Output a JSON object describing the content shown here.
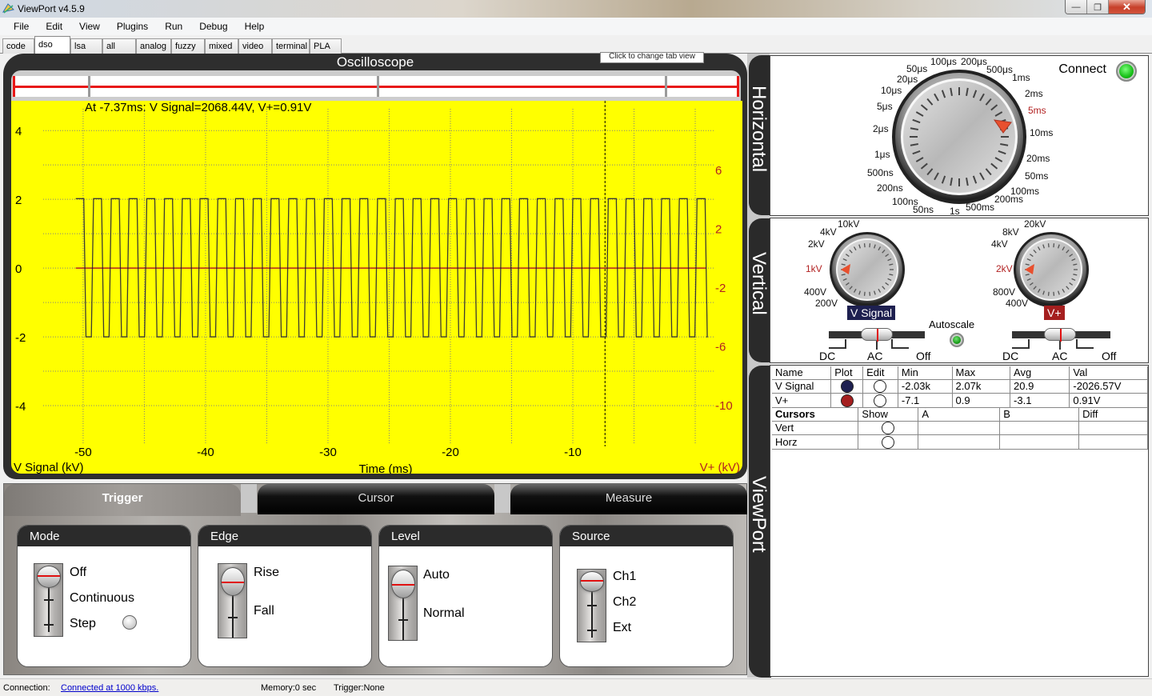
{
  "window": {
    "title": "ViewPort v4.5.9",
    "minimize": "—",
    "restore": "❐",
    "close": "✕"
  },
  "menu": [
    "File",
    "Edit",
    "View",
    "Plugins",
    "Run",
    "Debug",
    "Help"
  ],
  "tabs": [
    {
      "label": "code",
      "active": false
    },
    {
      "label": "dso",
      "active": true
    },
    {
      "label": "lsa",
      "active": false
    },
    {
      "label": "all",
      "active": false
    },
    {
      "label": "analog",
      "active": false
    },
    {
      "label": "fuzzy",
      "active": false
    },
    {
      "label": "mixed",
      "active": false
    },
    {
      "label": "video",
      "active": false
    },
    {
      "label": "terminal",
      "active": false
    },
    {
      "label": "PLA",
      "active": false
    }
  ],
  "oscilloscope": {
    "title": "Oscilloscope",
    "tab_hint": "Click to change tab view",
    "cursor_readout": "At -7.37ms: V Signal=2068.44V, V+=0.91V",
    "colors": {
      "background": "#ffff00",
      "signal": "#1a1a3a",
      "vplus": "#b22222",
      "grid": "#808080"
    }
  },
  "chart_data": {
    "type": "line",
    "title": "Oscilloscope",
    "xlabel": "Time (ms)",
    "ylabel": "V Signal (kV)",
    "y2label": "V+ (kV)",
    "xlim": [
      -53,
      1.5
    ],
    "ylim": [
      -5,
      4.4
    ],
    "y2lim": [
      -12.4,
      9.6
    ],
    "x_ticks": [
      -50,
      -40,
      -30,
      -20,
      -10
    ],
    "x_tick_labels": [
      "-50",
      "-40",
      "-30",
      "-20",
      "-10"
    ],
    "y_ticks": [
      4,
      2,
      0,
      -2,
      -4
    ],
    "y_tick_labels": [
      "4",
      "2",
      "0",
      "-2",
      "-4"
    ],
    "y2_ticks": [
      6,
      2,
      -2,
      -6,
      -10
    ],
    "y2_tick_labels": [
      "6",
      "2",
      "-2",
      "-6",
      "-10"
    ],
    "grid": true,
    "cursor_x": -7.37,
    "series": [
      {
        "name": "V Signal",
        "axis": "left",
        "shape": "square-wave",
        "high": 2.07,
        "low": -2.03,
        "x_start": -50.6,
        "x_end": 0.9,
        "period_ms": 1.45,
        "duty": 0.45
      },
      {
        "name": "V+",
        "axis": "right",
        "shape": "flat",
        "value": 0.0,
        "x_start": -50.6,
        "x_end": 0.9
      }
    ]
  },
  "trigger_panel": {
    "tabs": [
      {
        "label": "Trigger",
        "active": true
      },
      {
        "label": "Cursor",
        "active": false
      },
      {
        "label": "Measure",
        "active": false
      }
    ],
    "groups": [
      {
        "title": "Mode",
        "options": [
          "Off",
          "Continuous",
          "Step"
        ],
        "selected": "Off"
      },
      {
        "title": "Edge",
        "options": [
          "Rise",
          "Fall"
        ],
        "selected": "Rise"
      },
      {
        "title": "Level",
        "options": [
          "Auto",
          "Normal"
        ],
        "selected": "Auto"
      },
      {
        "title": "Source",
        "options": [
          "Ch1",
          "Ch2",
          "Ext"
        ],
        "selected": "Ch1"
      }
    ]
  },
  "side_tabs": [
    "Horizontal",
    "Vertical",
    "ViewPort"
  ],
  "horizontal": {
    "connect_label": "Connect",
    "timebase_labels": [
      "1s",
      "500ms",
      "200ms",
      "100ms",
      "50ms",
      "20ms",
      "10ms",
      "5ms",
      "2ms",
      "1ms",
      "500μs",
      "200μs",
      "100μs",
      "50μs",
      "20μs",
      "10μs",
      "5μs",
      "2μs",
      "1μs",
      "500ns",
      "200ns",
      "100ns",
      "50ns"
    ],
    "selected_timebase": "5ms"
  },
  "vertical": {
    "channels": [
      {
        "name": "V Signal",
        "color": "#1e2050",
        "scale_labels": [
          "10kV",
          "4kV",
          "2kV",
          "1kV",
          "400V",
          "200V"
        ],
        "selected": "1kV",
        "coupling": [
          "DC",
          "AC",
          "Off"
        ],
        "coupling_selected": "AC"
      },
      {
        "name": "V+",
        "color": "#a51f1f",
        "scale_labels": [
          "20kV",
          "8kV",
          "4kV",
          "2kV",
          "800V",
          "400V"
        ],
        "selected": "2kV",
        "coupling": [
          "DC",
          "AC",
          "Off"
        ],
        "coupling_selected": "AC"
      }
    ],
    "autoscale_label": "Autoscale"
  },
  "measurements": {
    "headers": [
      "Name",
      "Plot",
      "Edit",
      "Min",
      "Max",
      "Avg",
      "Val"
    ],
    "rows": [
      {
        "name": "V Signal",
        "plot_color": "#1e2050",
        "min": "-2.03k",
        "max": "2.07k",
        "avg": "20.9",
        "val": "-2026.57V"
      },
      {
        "name": "V+",
        "plot_color": "#a51f1f",
        "min": "-7.1",
        "max": "0.9",
        "avg": "-3.1",
        "val": "0.91V"
      }
    ],
    "cursor_headers": [
      "Cursors",
      "Show",
      "A",
      "B",
      "Diff"
    ],
    "cursor_rows": [
      {
        "name": "Vert",
        "a": "",
        "b": "",
        "diff": ""
      },
      {
        "name": "Horz",
        "a": "",
        "b": "",
        "diff": ""
      }
    ]
  },
  "status": {
    "connection_label": "Connection:",
    "connection_value": "Connected at 1000 kbps.",
    "memory": "Memory:0 sec",
    "trigger": "Trigger:None"
  }
}
